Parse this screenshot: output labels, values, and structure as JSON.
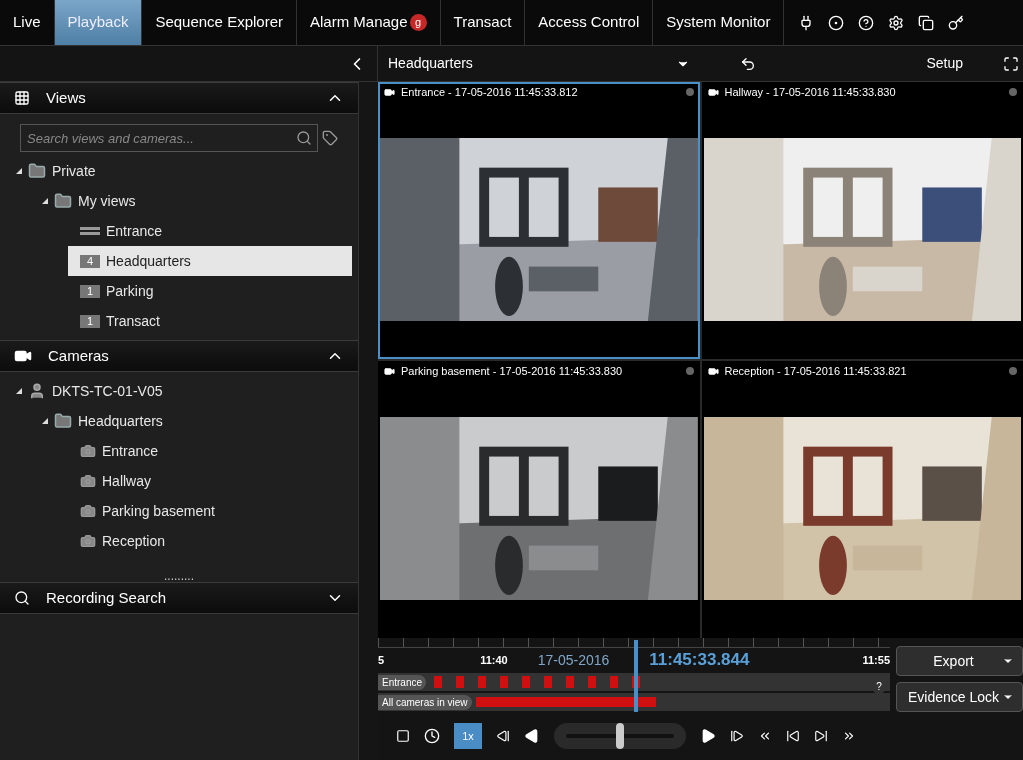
{
  "tabs": [
    {
      "label": "Live",
      "selected": false
    },
    {
      "label": "Playback",
      "selected": true
    },
    {
      "label": "Sequence Explorer",
      "selected": false
    },
    {
      "label": "Alarm Manage",
      "selected": false,
      "badge": "g"
    },
    {
      "label": "Transact",
      "selected": false
    },
    {
      "label": "Access Control",
      "selected": false
    },
    {
      "label": "System Monitor",
      "selected": false
    }
  ],
  "toolbar": {
    "view_name": "Headquarters",
    "setup": "Setup"
  },
  "views_panel": {
    "title": "Views",
    "expanded": true,
    "search": {
      "placeholder": "Search views and cameras..."
    },
    "tree": [
      {
        "kind": "folder",
        "label": "Private",
        "expanded": true,
        "selected": false,
        "children": [
          {
            "kind": "folder",
            "label": "My views",
            "expanded": true,
            "selected": false,
            "children": [
              {
                "kind": "layout",
                "label": "Entrance",
                "selected": false
              },
              {
                "kind": "view",
                "count": "4",
                "label": "Headquarters",
                "selected": true
              },
              {
                "kind": "view",
                "count": "1",
                "label": "Parking",
                "selected": false
              },
              {
                "kind": "view",
                "count": "1",
                "label": "Transact",
                "selected": false
              }
            ]
          }
        ]
      }
    ]
  },
  "cameras_panel": {
    "title": "Cameras",
    "expanded": true,
    "more": ".........",
    "tree": [
      {
        "kind": "server",
        "label": "DKTS-TC-01-V05",
        "expanded": true,
        "selected": false,
        "children": [
          {
            "kind": "folder",
            "label": "Headquarters",
            "expanded": true,
            "selected": false,
            "children": [
              {
                "kind": "camera",
                "label": "Entrance",
                "selected": false
              },
              {
                "kind": "camera",
                "label": "Hallway",
                "selected": false
              },
              {
                "kind": "camera",
                "label": "Parking basement",
                "selected": false
              },
              {
                "kind": "camera",
                "label": "Reception",
                "selected": false
              }
            ]
          }
        ]
      }
    ]
  },
  "recording_search": {
    "title": "Recording Search",
    "expanded": false
  },
  "video_cells": [
    {
      "title": "Entrance - 17-05-2016 11:45:33.812",
      "selected": true
    },
    {
      "title": "Hallway - 17-05-2016 11:45:33.830",
      "selected": false
    },
    {
      "title": "Parking basement - 17-05-2016 11:45:33.830",
      "selected": false
    },
    {
      "title": "Reception - 17-05-2016 11:45:33.821",
      "selected": false
    }
  ],
  "timeline": {
    "tick_labels": [
      "5",
      "11:40",
      "11:55"
    ],
    "date": "17-05-2016",
    "time": "11:45:33.844",
    "tracks": [
      {
        "label": "Entrance",
        "kind": "marks"
      },
      {
        "label": "All cameras in view",
        "kind": "bar"
      }
    ],
    "help": "?",
    "speed": "1x",
    "jog": {
      "level": 0.5
    }
  },
  "actions": [
    {
      "label": "Export"
    },
    {
      "label": "Evidence Lock"
    }
  ]
}
